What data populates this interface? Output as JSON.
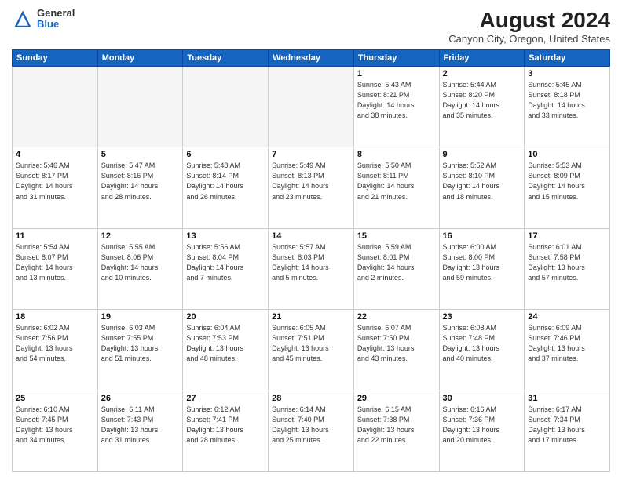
{
  "header": {
    "logo_general": "General",
    "logo_blue": "Blue",
    "month_year": "August 2024",
    "location": "Canyon City, Oregon, United States"
  },
  "days_of_week": [
    "Sunday",
    "Monday",
    "Tuesday",
    "Wednesday",
    "Thursday",
    "Friday",
    "Saturday"
  ],
  "weeks": [
    [
      {
        "day": "",
        "empty": true
      },
      {
        "day": "",
        "empty": true
      },
      {
        "day": "",
        "empty": true
      },
      {
        "day": "",
        "empty": true
      },
      {
        "day": "1",
        "info": "Sunrise: 5:43 AM\nSunset: 8:21 PM\nDaylight: 14 hours\nand 38 minutes."
      },
      {
        "day": "2",
        "info": "Sunrise: 5:44 AM\nSunset: 8:20 PM\nDaylight: 14 hours\nand 35 minutes."
      },
      {
        "day": "3",
        "info": "Sunrise: 5:45 AM\nSunset: 8:18 PM\nDaylight: 14 hours\nand 33 minutes."
      }
    ],
    [
      {
        "day": "4",
        "info": "Sunrise: 5:46 AM\nSunset: 8:17 PM\nDaylight: 14 hours\nand 31 minutes."
      },
      {
        "day": "5",
        "info": "Sunrise: 5:47 AM\nSunset: 8:16 PM\nDaylight: 14 hours\nand 28 minutes."
      },
      {
        "day": "6",
        "info": "Sunrise: 5:48 AM\nSunset: 8:14 PM\nDaylight: 14 hours\nand 26 minutes."
      },
      {
        "day": "7",
        "info": "Sunrise: 5:49 AM\nSunset: 8:13 PM\nDaylight: 14 hours\nand 23 minutes."
      },
      {
        "day": "8",
        "info": "Sunrise: 5:50 AM\nSunset: 8:11 PM\nDaylight: 14 hours\nand 21 minutes."
      },
      {
        "day": "9",
        "info": "Sunrise: 5:52 AM\nSunset: 8:10 PM\nDaylight: 14 hours\nand 18 minutes."
      },
      {
        "day": "10",
        "info": "Sunrise: 5:53 AM\nSunset: 8:09 PM\nDaylight: 14 hours\nand 15 minutes."
      }
    ],
    [
      {
        "day": "11",
        "info": "Sunrise: 5:54 AM\nSunset: 8:07 PM\nDaylight: 14 hours\nand 13 minutes."
      },
      {
        "day": "12",
        "info": "Sunrise: 5:55 AM\nSunset: 8:06 PM\nDaylight: 14 hours\nand 10 minutes."
      },
      {
        "day": "13",
        "info": "Sunrise: 5:56 AM\nSunset: 8:04 PM\nDaylight: 14 hours\nand 7 minutes."
      },
      {
        "day": "14",
        "info": "Sunrise: 5:57 AM\nSunset: 8:03 PM\nDaylight: 14 hours\nand 5 minutes."
      },
      {
        "day": "15",
        "info": "Sunrise: 5:59 AM\nSunset: 8:01 PM\nDaylight: 14 hours\nand 2 minutes."
      },
      {
        "day": "16",
        "info": "Sunrise: 6:00 AM\nSunset: 8:00 PM\nDaylight: 13 hours\nand 59 minutes."
      },
      {
        "day": "17",
        "info": "Sunrise: 6:01 AM\nSunset: 7:58 PM\nDaylight: 13 hours\nand 57 minutes."
      }
    ],
    [
      {
        "day": "18",
        "info": "Sunrise: 6:02 AM\nSunset: 7:56 PM\nDaylight: 13 hours\nand 54 minutes."
      },
      {
        "day": "19",
        "info": "Sunrise: 6:03 AM\nSunset: 7:55 PM\nDaylight: 13 hours\nand 51 minutes."
      },
      {
        "day": "20",
        "info": "Sunrise: 6:04 AM\nSunset: 7:53 PM\nDaylight: 13 hours\nand 48 minutes."
      },
      {
        "day": "21",
        "info": "Sunrise: 6:05 AM\nSunset: 7:51 PM\nDaylight: 13 hours\nand 45 minutes."
      },
      {
        "day": "22",
        "info": "Sunrise: 6:07 AM\nSunset: 7:50 PM\nDaylight: 13 hours\nand 43 minutes."
      },
      {
        "day": "23",
        "info": "Sunrise: 6:08 AM\nSunset: 7:48 PM\nDaylight: 13 hours\nand 40 minutes."
      },
      {
        "day": "24",
        "info": "Sunrise: 6:09 AM\nSunset: 7:46 PM\nDaylight: 13 hours\nand 37 minutes."
      }
    ],
    [
      {
        "day": "25",
        "info": "Sunrise: 6:10 AM\nSunset: 7:45 PM\nDaylight: 13 hours\nand 34 minutes."
      },
      {
        "day": "26",
        "info": "Sunrise: 6:11 AM\nSunset: 7:43 PM\nDaylight: 13 hours\nand 31 minutes."
      },
      {
        "day": "27",
        "info": "Sunrise: 6:12 AM\nSunset: 7:41 PM\nDaylight: 13 hours\nand 28 minutes."
      },
      {
        "day": "28",
        "info": "Sunrise: 6:14 AM\nSunset: 7:40 PM\nDaylight: 13 hours\nand 25 minutes."
      },
      {
        "day": "29",
        "info": "Sunrise: 6:15 AM\nSunset: 7:38 PM\nDaylight: 13 hours\nand 22 minutes."
      },
      {
        "day": "30",
        "info": "Sunrise: 6:16 AM\nSunset: 7:36 PM\nDaylight: 13 hours\nand 20 minutes."
      },
      {
        "day": "31",
        "info": "Sunrise: 6:17 AM\nSunset: 7:34 PM\nDaylight: 13 hours\nand 17 minutes."
      }
    ]
  ]
}
